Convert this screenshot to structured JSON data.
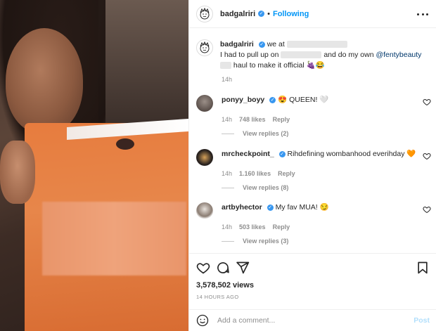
{
  "post": {
    "author": "badgalriri",
    "follow_label": "Following",
    "separator": "•",
    "caption_prefix": "we at",
    "caption_line2a": "I had to pull up on",
    "caption_line2b": "and do my own",
    "caption_mention": "@fentybeauty",
    "caption_line3": "haul to make it official 🍇😂",
    "caption_time": "14h"
  },
  "comments": [
    {
      "user": "ponyy_boyy",
      "text": "😍 QUEEN! 🤍",
      "time": "14h",
      "likes": "748 likes",
      "reply": "Reply",
      "replies": "View replies (2)"
    },
    {
      "user": "mrcheckpoint_",
      "text": "Rihdefining wombanhood everihday 🧡",
      "time": "14h",
      "likes": "1.160 likes",
      "reply": "Reply",
      "replies": "View replies (8)"
    },
    {
      "user": "artbyhector",
      "text": "My fav MUA! 😏",
      "time": "14h",
      "likes": "503 likes",
      "reply": "Reply",
      "replies": "View replies (3)"
    }
  ],
  "stats": {
    "views": "3,578,502 views",
    "ago": "14 HOURS AGO"
  },
  "composer": {
    "placeholder": "Add a comment...",
    "post_label": "Post"
  },
  "colors": {
    "accent": "#0095f6",
    "verified": "#3897f0",
    "muted": "#8e8e8e"
  },
  "icons": [
    "heart-icon",
    "comment-icon",
    "share-icon",
    "bookmark-icon",
    "emoji-icon",
    "more-icon",
    "verified-icon"
  ]
}
